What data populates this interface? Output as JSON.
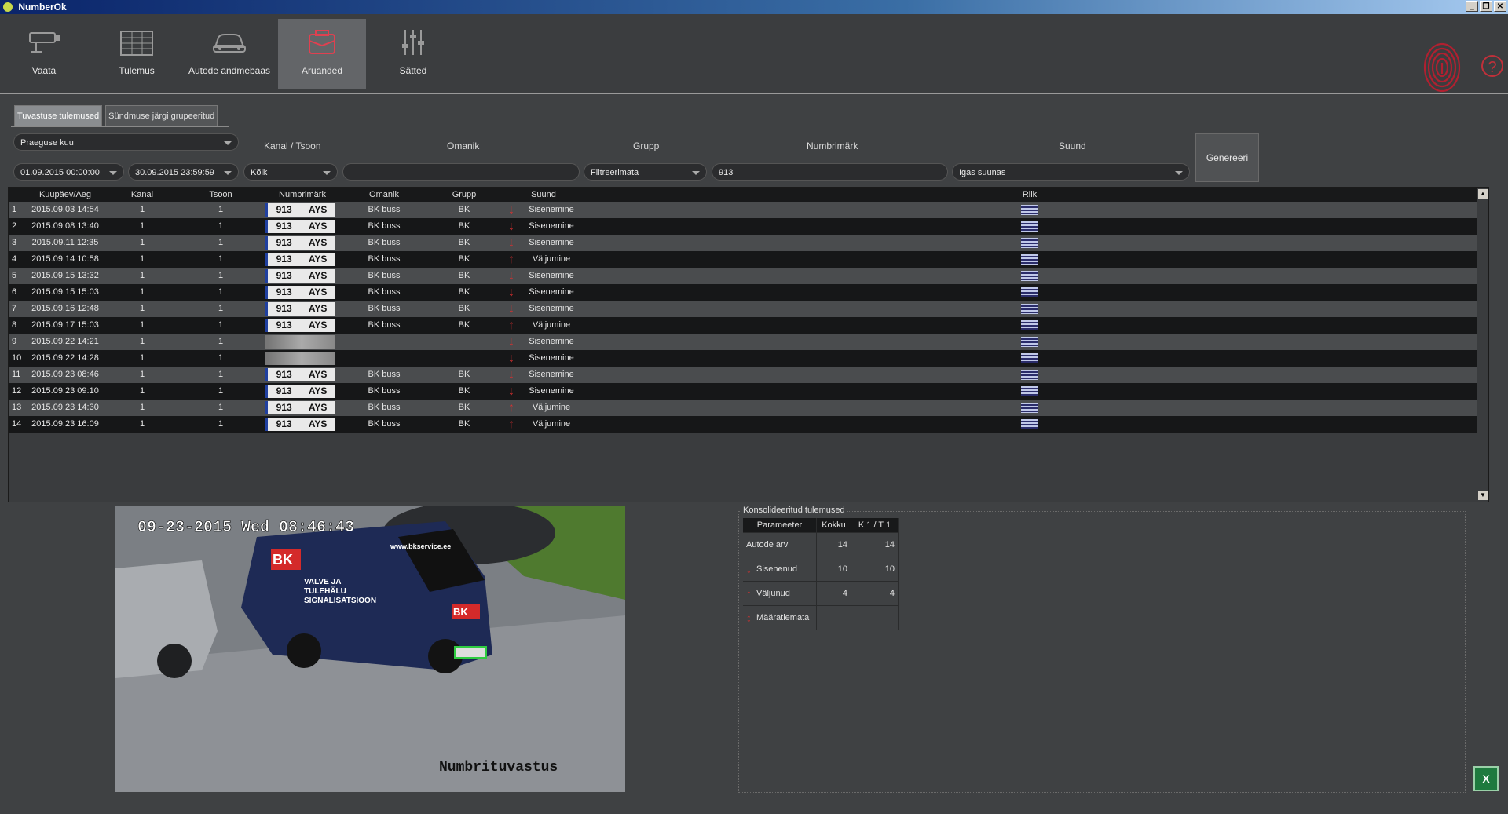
{
  "window": {
    "title": "NumberOk",
    "buttons": [
      "_",
      "❐",
      "✕"
    ]
  },
  "toolbar": {
    "items": [
      {
        "label": "Vaata",
        "icon": "camera-icon",
        "active": false
      },
      {
        "label": "Tulemus",
        "icon": "results-list-icon",
        "active": false
      },
      {
        "label": "Autode andmebaas",
        "icon": "car-icon",
        "active": false
      },
      {
        "label": "Aruanded",
        "icon": "reports-icon",
        "active": true
      },
      {
        "label": "Sätted",
        "icon": "settings-sliders-icon",
        "active": false
      }
    ],
    "help": "?"
  },
  "tabs": [
    {
      "label": "Tuvastuse tulemused",
      "active": true
    },
    {
      "label": "Sündmuse järgi grupeeritud",
      "active": false
    }
  ],
  "filters": {
    "period": "Praeguse kuu",
    "date_from": "01.09.2015 00:00:00",
    "date_to": "30.09.2015 23:59:59",
    "labels": {
      "channel_zone": "Kanal / Tsoon",
      "owner": "Omanik",
      "group": "Grupp",
      "plate": "Numbrimärk",
      "direction": "Suund"
    },
    "channel_zone": "Kõik",
    "owner": "",
    "group": "Filtreerimata",
    "plate": "913",
    "direction": "Igas suunas",
    "generate_button": "Genereeri"
  },
  "grid": {
    "columns": [
      "",
      "Kuupäev/Aeg",
      "Kanal",
      "Tsoon",
      "Numbrimärk",
      "Omanik",
      "Grupp",
      "Suund",
      "Riik"
    ],
    "rows": [
      {
        "n": "1",
        "datetime": "2015.09.03 14:54",
        "channel": "1",
        "zone": "1",
        "plate_num": "913",
        "plate_letters": "AYS",
        "owner": "BK buss",
        "group": "BK",
        "dir_arrow": "↓",
        "direction": "Sisenemine",
        "plate_visible": true
      },
      {
        "n": "2",
        "datetime": "2015.09.08 13:40",
        "channel": "1",
        "zone": "1",
        "plate_num": "913",
        "plate_letters": "AYS",
        "owner": "BK buss",
        "group": "BK",
        "dir_arrow": "↓",
        "direction": "Sisenemine",
        "plate_visible": true
      },
      {
        "n": "3",
        "datetime": "2015.09.11 12:35",
        "channel": "1",
        "zone": "1",
        "plate_num": "913",
        "plate_letters": "AYS",
        "owner": "BK buss",
        "group": "BK",
        "dir_arrow": "↓",
        "direction": "Sisenemine",
        "plate_visible": true
      },
      {
        "n": "4",
        "datetime": "2015.09.14 10:58",
        "channel": "1",
        "zone": "1",
        "plate_num": "913",
        "plate_letters": "AYS",
        "owner": "BK buss",
        "group": "BK",
        "dir_arrow": "↑",
        "direction": "Väljumine",
        "plate_visible": true
      },
      {
        "n": "5",
        "datetime": "2015.09.15 13:32",
        "channel": "1",
        "zone": "1",
        "plate_num": "913",
        "plate_letters": "AYS",
        "owner": "BK buss",
        "group": "BK",
        "dir_arrow": "↓",
        "direction": "Sisenemine",
        "plate_visible": true
      },
      {
        "n": "6",
        "datetime": "2015.09.15 15:03",
        "channel": "1",
        "zone": "1",
        "plate_num": "913",
        "plate_letters": "AYS",
        "owner": "BK buss",
        "group": "BK",
        "dir_arrow": "↓",
        "direction": "Sisenemine",
        "plate_visible": true
      },
      {
        "n": "7",
        "datetime": "2015.09.16 12:48",
        "channel": "1",
        "zone": "1",
        "plate_num": "913",
        "plate_letters": "AYS",
        "owner": "BK buss",
        "group": "BK",
        "dir_arrow": "↓",
        "direction": "Sisenemine",
        "plate_visible": true
      },
      {
        "n": "8",
        "datetime": "2015.09.17 15:03",
        "channel": "1",
        "zone": "1",
        "plate_num": "913",
        "plate_letters": "AYS",
        "owner": "BK buss",
        "group": "BK",
        "dir_arrow": "↑",
        "direction": "Väljumine",
        "plate_visible": true
      },
      {
        "n": "9",
        "datetime": "2015.09.22 14:21",
        "channel": "1",
        "zone": "1",
        "plate_num": "",
        "plate_letters": "",
        "owner": "",
        "group": "",
        "dir_arrow": "↓",
        "direction": "Sisenemine",
        "plate_visible": false
      },
      {
        "n": "10",
        "datetime": "2015.09.22 14:28",
        "channel": "1",
        "zone": "1",
        "plate_num": "",
        "plate_letters": "",
        "owner": "",
        "group": "",
        "dir_arrow": "↓",
        "direction": "Sisenemine",
        "plate_visible": false
      },
      {
        "n": "11",
        "datetime": "2015.09.23 08:46",
        "channel": "1",
        "zone": "1",
        "plate_num": "913",
        "plate_letters": "AYS",
        "owner": "BK buss",
        "group": "BK",
        "dir_arrow": "↓",
        "direction": "Sisenemine",
        "plate_visible": true
      },
      {
        "n": "12",
        "datetime": "2015.09.23 09:10",
        "channel": "1",
        "zone": "1",
        "plate_num": "913",
        "plate_letters": "AYS",
        "owner": "BK buss",
        "group": "BK",
        "dir_arrow": "↓",
        "direction": "Sisenemine",
        "plate_visible": true
      },
      {
        "n": "13",
        "datetime": "2015.09.23 14:30",
        "channel": "1",
        "zone": "1",
        "plate_num": "913",
        "plate_letters": "AYS",
        "owner": "BK buss",
        "group": "BK",
        "dir_arrow": "↑",
        "direction": "Väljumine",
        "plate_visible": true
      },
      {
        "n": "14",
        "datetime": "2015.09.23 16:09",
        "channel": "1",
        "zone": "1",
        "plate_num": "913",
        "plate_letters": "AYS",
        "owner": "BK buss",
        "group": "BK",
        "dir_arrow": "↑",
        "direction": "Väljumine",
        "plate_visible": true
      }
    ]
  },
  "camera": {
    "timestamp": "09-23-2015 Wed 08:46:43",
    "caption": "Numbrituvastus",
    "van_logo": "BK",
    "van_text": [
      "VALVE JA",
      "TULEHÄLU",
      "SIGNALISATSIOON"
    ],
    "van_url": "www.bkservice.ee"
  },
  "consolidated": {
    "title": "Konsolideeritud tulemused",
    "headers": [
      "Parameeter",
      "Kokku",
      "K 1 / T 1"
    ],
    "rows": [
      {
        "icon": "",
        "label": "Autode arv",
        "total": "14",
        "k1t1": "14"
      },
      {
        "icon": "arrow-down-icon",
        "label": "Sisenenud",
        "total": "10",
        "k1t1": "10"
      },
      {
        "icon": "arrow-up-icon",
        "label": "Väljunud",
        "total": "4",
        "k1t1": "4"
      },
      {
        "icon": "arrow-updown-icon",
        "label": "Määratlemata",
        "total": "",
        "k1t1": ""
      }
    ]
  },
  "colors": {
    "accent_red": "#e03030",
    "active_tab": "#636568",
    "dark_row": "#161718",
    "light_row": "#4a4c4e"
  }
}
